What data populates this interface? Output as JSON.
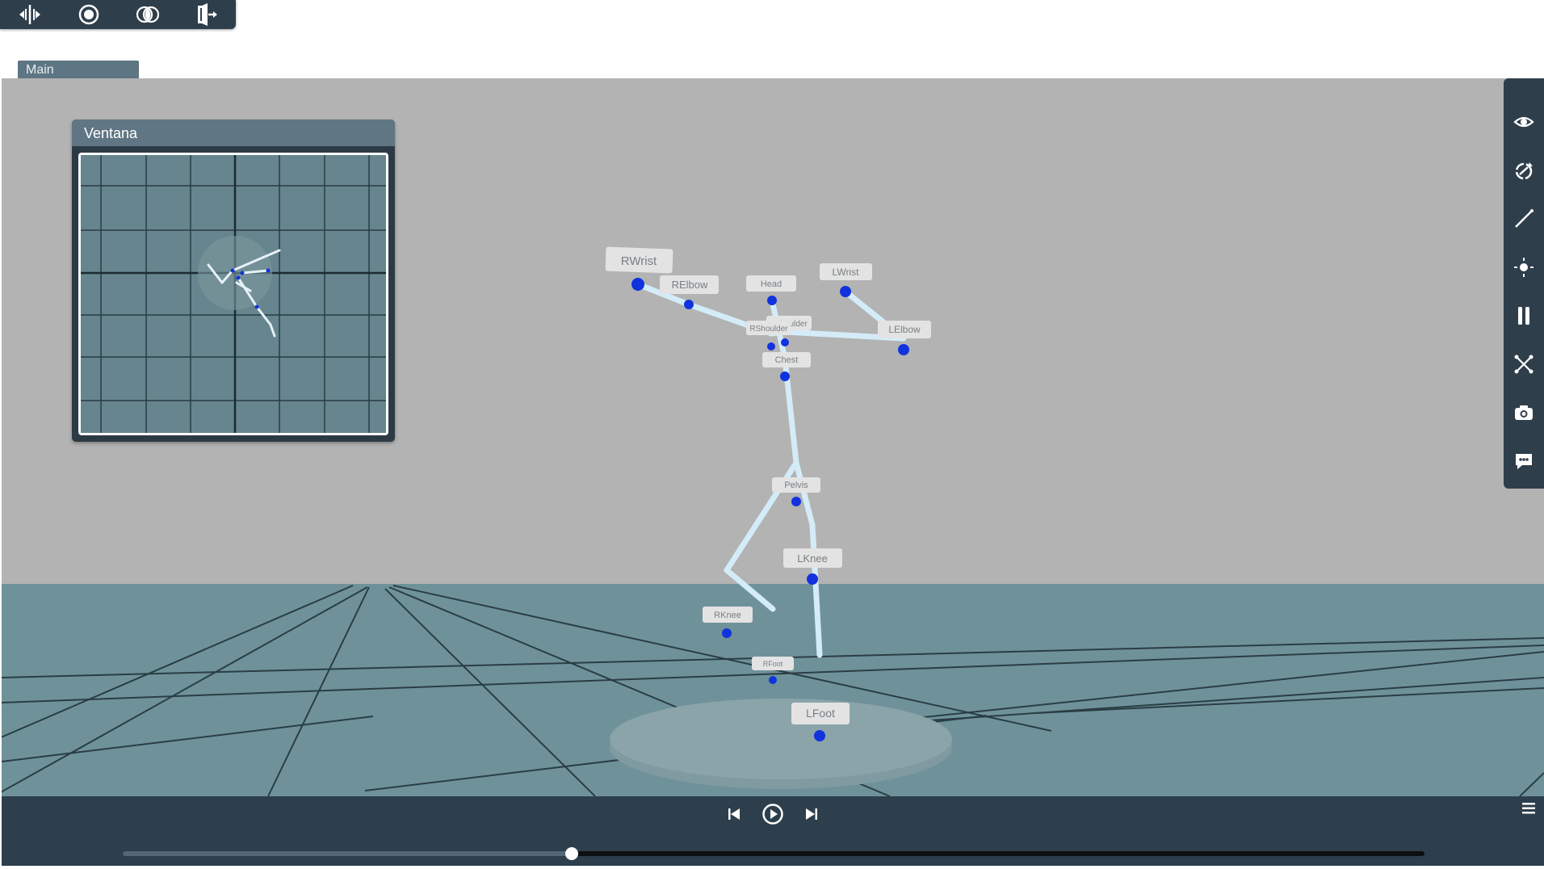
{
  "toolbar": {
    "items": [
      {
        "name": "split-view-icon"
      },
      {
        "name": "record-icon"
      },
      {
        "name": "compare-icon"
      },
      {
        "name": "exit-icon"
      }
    ]
  },
  "main_tab": {
    "label": "Main"
  },
  "minimap": {
    "title": "Ventana"
  },
  "right_toolbar": {
    "items": [
      {
        "name": "eye-icon"
      },
      {
        "name": "rotate-icon"
      },
      {
        "name": "measure-line-icon"
      },
      {
        "name": "light-icon"
      },
      {
        "name": "pause-icon"
      },
      {
        "name": "scatter-icon"
      },
      {
        "name": "camera-icon"
      },
      {
        "name": "chat-icon"
      }
    ]
  },
  "skeleton": {
    "joints": [
      {
        "label": "RWrist"
      },
      {
        "label": "RElbow"
      },
      {
        "label": "Head"
      },
      {
        "label": "LWrist"
      },
      {
        "label": "LElbow"
      },
      {
        "label": "RShoulder"
      },
      {
        "label": "LShoulder"
      },
      {
        "label": "Chest"
      },
      {
        "label": "Pelvis"
      },
      {
        "label": "LKnee"
      },
      {
        "label": "RKnee"
      },
      {
        "label": "RFoot"
      },
      {
        "label": "LFoot"
      }
    ]
  },
  "playback": {
    "progress": 0.345,
    "colors": {
      "played": "#536777",
      "remaining": "#0d0f12",
      "handle": "#ffffff"
    }
  },
  "colors": {
    "toolbar_bg": "#2f3e4b",
    "tab_bg": "#5e7583",
    "sky": "#b3b3b3",
    "floor": "#6f929a",
    "bone": "#d3ecf8",
    "joint": "#1133dd"
  }
}
